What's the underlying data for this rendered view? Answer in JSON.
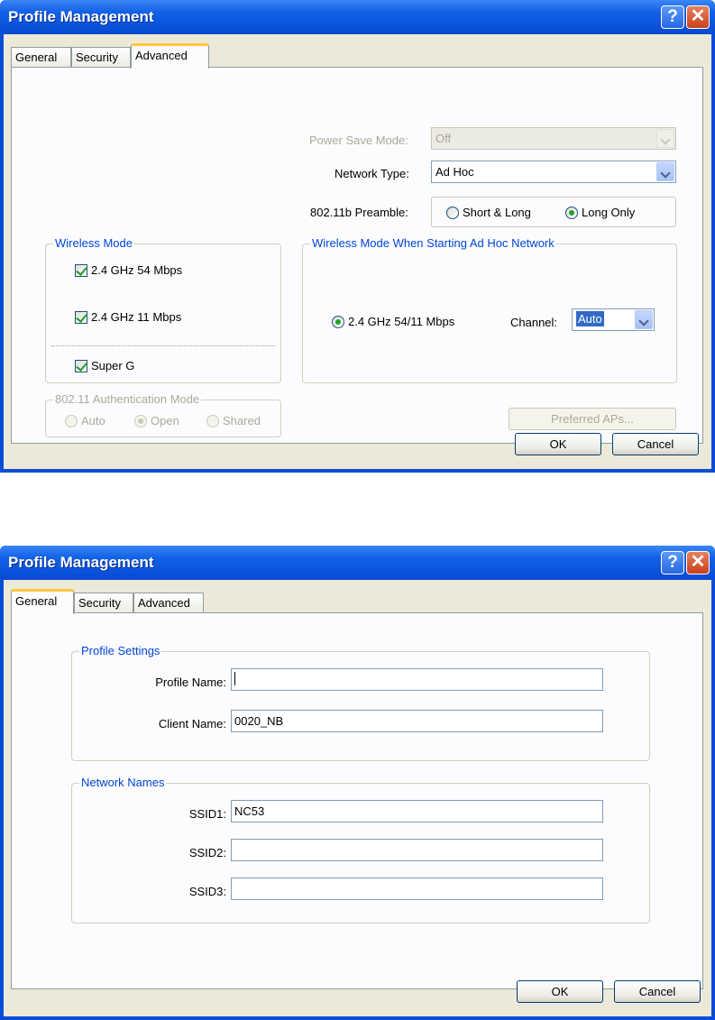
{
  "dialogs": {
    "advanced": {
      "title": "Profile Management",
      "help_glyph": "?",
      "close_glyph": "✕",
      "tabs": [
        "General",
        "Security",
        "Advanced"
      ],
      "active_tab": "Advanced",
      "power_save": {
        "label": "Power Save Mode:",
        "value": "Off",
        "enabled": false
      },
      "network_type": {
        "label": "Network Type:",
        "value": "Ad Hoc"
      },
      "preamble": {
        "label": "802.11b Preamble:",
        "options": [
          "Short & Long",
          "Long Only"
        ],
        "selected": "Long Only"
      },
      "wireless_mode": {
        "title": "Wireless Mode",
        "options": [
          {
            "label": "2.4 GHz 54 Mbps",
            "checked": true
          },
          {
            "label": "2.4 GHz 11 Mbps",
            "checked": true
          }
        ],
        "super_g": {
          "label": "Super G",
          "checked": true
        }
      },
      "adhoc_mode": {
        "title": "Wireless Mode When Starting Ad Hoc Network",
        "radio_label": "2.4 GHz 54/11 Mbps",
        "radio_selected": true,
        "channel_label": "Channel:",
        "channel_value": "Auto"
      },
      "auth_mode": {
        "title": "802.11 Authentication Mode",
        "options": [
          "Auto",
          "Open",
          "Shared"
        ],
        "selected": "Open",
        "enabled": false
      },
      "preferred_aps": {
        "label": "Preferred APs...",
        "enabled": false
      },
      "ok_label": "OK",
      "cancel_label": "Cancel"
    },
    "general": {
      "title": "Profile Management",
      "help_glyph": "?",
      "close_glyph": "✕",
      "tabs": [
        "General",
        "Security",
        "Advanced"
      ],
      "active_tab": "General",
      "profile_settings": {
        "title": "Profile Settings",
        "profile_name_label": "Profile Name:",
        "profile_name_value": "",
        "client_name_label": "Client Name:",
        "client_name_value": "0020_NB"
      },
      "network_names": {
        "title": "Network Names",
        "ssid1_label": "SSID1:",
        "ssid1_value": "NC53",
        "ssid2_label": "SSID2:",
        "ssid2_value": "",
        "ssid3_label": "SSID3:",
        "ssid3_value": ""
      },
      "ok_label": "OK",
      "cancel_label": "Cancel"
    }
  },
  "colors": {
    "titlebar": "#0a50d9",
    "dialog_face": "#ece9d8",
    "group_title": "#0046d5",
    "active_tab_accent": "#ffc83c",
    "checkmark": "#21a121"
  }
}
